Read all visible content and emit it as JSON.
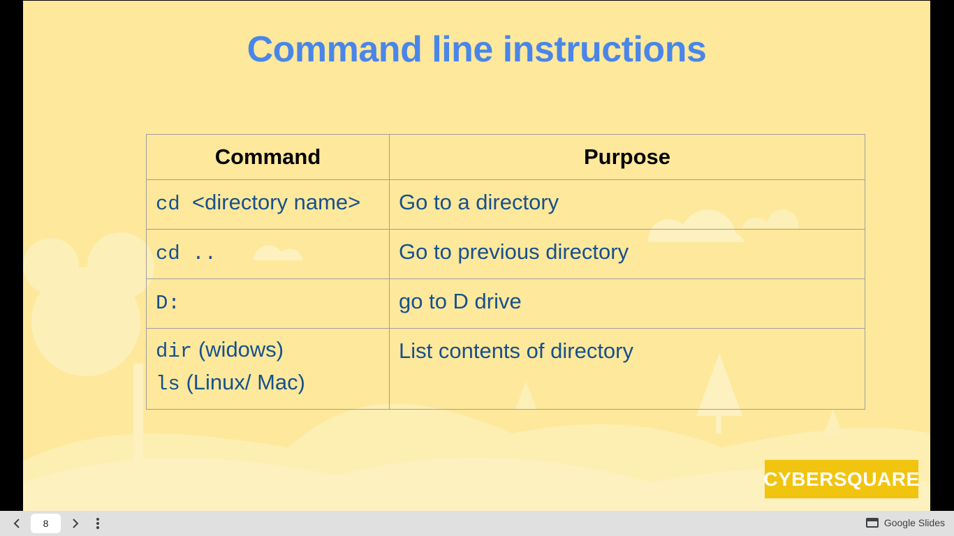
{
  "slide": {
    "title": "Command line instructions",
    "table": {
      "headers": [
        "Command",
        "Purpose"
      ],
      "rows": [
        {
          "cmd_mono": "cd",
          "cmd_text": "<directory name>",
          "purpose": "Go to a directory"
        },
        {
          "cmd_mono": "cd ..",
          "cmd_text": "",
          "purpose": "Go to previous directory"
        },
        {
          "cmd_mono": "D:",
          "cmd_text": "",
          "purpose": "go to D drive"
        },
        {
          "cmd_mono": "dir",
          "cmd_text": "(widows)",
          "cmd_mono_2": "ls",
          "cmd_text_2": "(Linux/ Mac)",
          "purpose": "List contents of directory"
        }
      ]
    },
    "logo_text": "CYBERSQUARE"
  },
  "bottom_bar": {
    "prev_icon": "chevron-left-icon",
    "page_number": "8",
    "next_icon": "chevron-right-icon",
    "more_icon": "more-vert-icon",
    "brand_label": "Google Slides"
  },
  "colors": {
    "slide_bg": "#fee89c",
    "title": "#4a86e8",
    "cell_text": "#17508b",
    "logo_bg": "#f1c40f"
  }
}
